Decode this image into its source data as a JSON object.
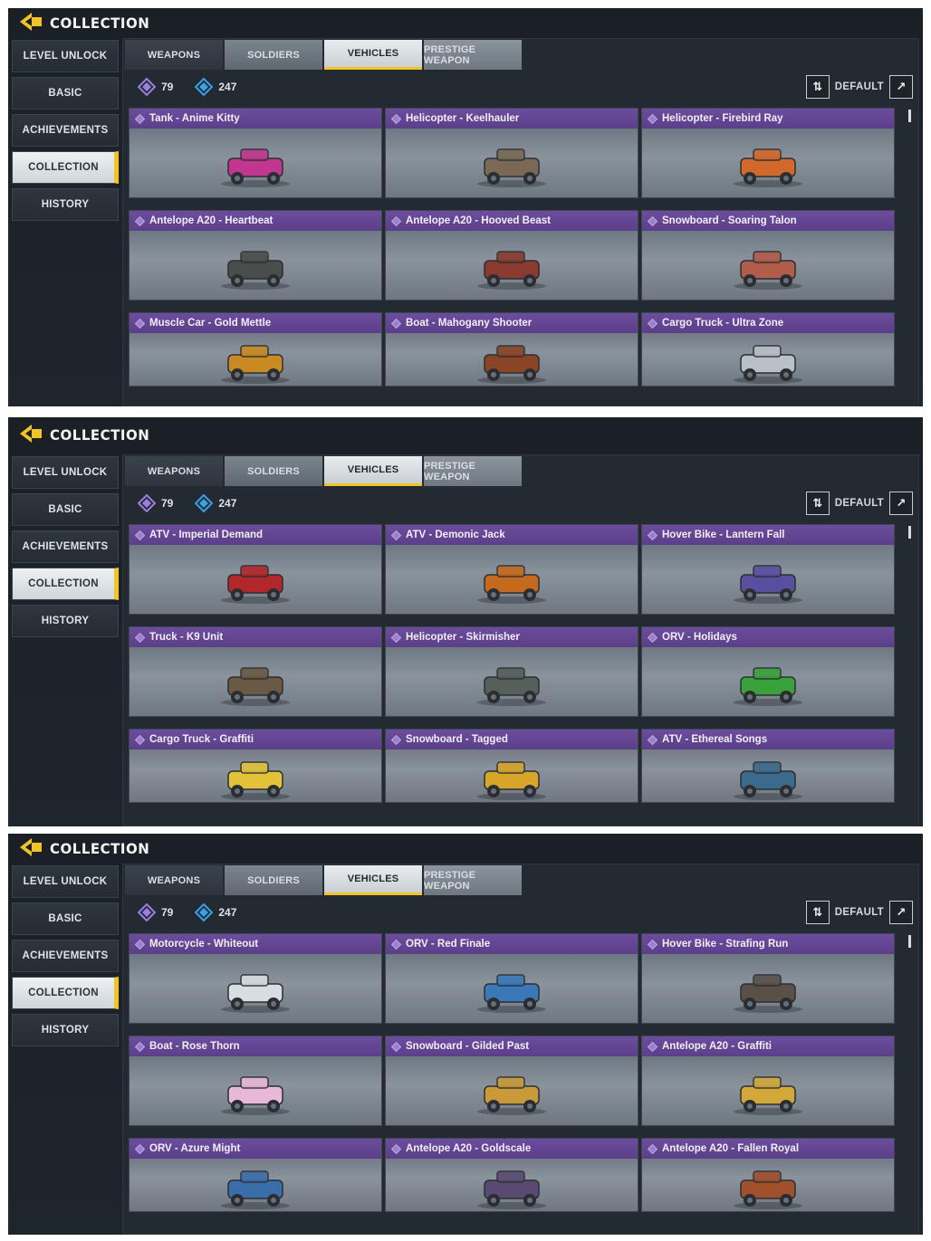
{
  "screens": [
    {
      "header_title": "COLLECTION",
      "sidebar": [
        "LEVEL UNLOCK",
        "BASIC",
        "ACHIEVEMENTS",
        "COLLECTION",
        "HISTORY"
      ],
      "tabs": [
        "WEAPONS",
        "SOLDIERS",
        "VEHICLES",
        "PRESTIGE WEAPON"
      ],
      "currency_a": "79",
      "currency_b": "247",
      "sort_label": "DEFAULT",
      "cards": [
        {
          "name": "Tank - Anime Kitty",
          "color": "#c1378f"
        },
        {
          "name": "Helicopter - Keelhauler",
          "color": "#7a6a55"
        },
        {
          "name": "Helicopter - Firebird Ray",
          "color": "#d2692a"
        },
        {
          "name": "Antelope A20 - Heartbeat",
          "color": "#4a4e4a"
        },
        {
          "name": "Antelope A20 - Hooved Beast",
          "color": "#8a3a2e"
        },
        {
          "name": "Snowboard - Soaring Talon",
          "color": "#b25c4a"
        },
        {
          "name": "Muscle Car - Gold Mettle",
          "color": "#c98a22"
        },
        {
          "name": "Boat - Mahogany Shooter",
          "color": "#8a4426"
        },
        {
          "name": "Cargo Truck - Ultra Zone",
          "color": "#b8c0c8"
        }
      ]
    },
    {
      "header_title": "COLLECTION",
      "sidebar": [
        "LEVEL UNLOCK",
        "BASIC",
        "ACHIEVEMENTS",
        "COLLECTION",
        "HISTORY"
      ],
      "tabs": [
        "WEAPONS",
        "SOLDIERS",
        "VEHICLES",
        "PRESTIGE WEAPON"
      ],
      "currency_a": "79",
      "currency_b": "247",
      "sort_label": "DEFAULT",
      "cards": [
        {
          "name": "ATV - Imperial Demand",
          "color": "#b1272a"
        },
        {
          "name": "ATV - Demonic Jack",
          "color": "#c46a1e"
        },
        {
          "name": "Hover Bike - Lantern Fall",
          "color": "#5a4ea0"
        },
        {
          "name": "Truck - K9 Unit",
          "color": "#6a5a44"
        },
        {
          "name": "Helicopter - Skirmisher",
          "color": "#55605a"
        },
        {
          "name": "ORV - Holidays",
          "color": "#3aa23a"
        },
        {
          "name": "Cargo Truck - Graffiti",
          "color": "#e3c23a"
        },
        {
          "name": "Snowboard - Tagged",
          "color": "#d6a52a"
        },
        {
          "name": "ATV -  Ethereal Songs",
          "color": "#3c6a8c"
        }
      ]
    },
    {
      "header_title": "COLLECTION",
      "sidebar": [
        "LEVEL UNLOCK",
        "BASIC",
        "ACHIEVEMENTS",
        "COLLECTION",
        "HISTORY"
      ],
      "tabs": [
        "WEAPONS",
        "SOLDIERS",
        "VEHICLES",
        "PRESTIGE WEAPON"
      ],
      "currency_a": "79",
      "currency_b": "247",
      "sort_label": "DEFAULT",
      "cards": [
        {
          "name": "Motorcycle - Whiteout",
          "color": "#d8dde2"
        },
        {
          "name": "ORV -  Red Finale",
          "color": "#3a78b8"
        },
        {
          "name": "Hover Bike - Strafing Run",
          "color": "#5a5048"
        },
        {
          "name": "Boat - Rose Thorn",
          "color": "#e8b8d8"
        },
        {
          "name": "Snowboard - Gilded Past",
          "color": "#c89a3a"
        },
        {
          "name": "Antelope A20 - Graffiti",
          "color": "#d2a83a"
        },
        {
          "name": "ORV - Azure Might",
          "color": "#3a6ea8"
        },
        {
          "name": "Antelope A20 - Goldscale",
          "color": "#5a4a72"
        },
        {
          "name": "Antelope A20 - Fallen Royal",
          "color": "#a0502a"
        }
      ]
    }
  ],
  "colors": {
    "accent_yellow": "#f2c524",
    "card_title_purple": "#6d4c9e",
    "currency_purple": "#9b7fe0",
    "currency_blue": "#3aa0e8"
  }
}
